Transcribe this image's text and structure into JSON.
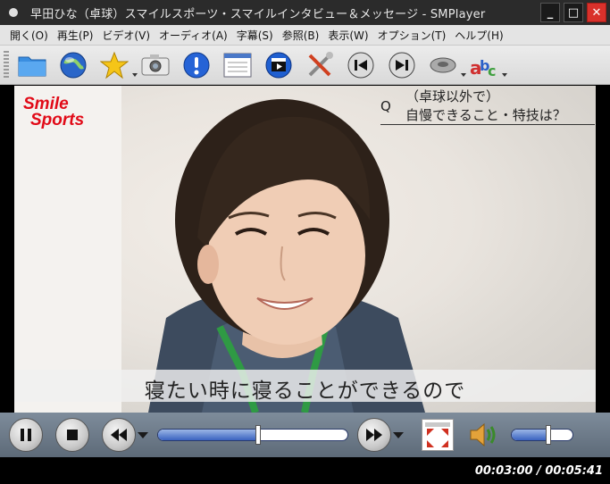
{
  "window": {
    "title": "早田ひな（卓球）スマイルスポーツ・スマイルインタビュー＆メッセージ - SMPlayer",
    "minimize_label": "_",
    "maximize_label": "□",
    "close_label": "✕"
  },
  "menu": {
    "items": [
      "開く(O)",
      "再生(P)",
      "ビデオ(V)",
      "オーディオ(A)",
      "字幕(S)",
      "参照(B)",
      "表示(W)",
      "オプション(T)",
      "ヘルプ(H)"
    ]
  },
  "toolbar": {
    "icons": [
      "folder-icon",
      "globe-icon",
      "star-icon",
      "camera-icon",
      "info-icon",
      "playlist-icon",
      "media-clapper-icon",
      "settings-tools-icon",
      "previous-icon",
      "next-icon",
      "audio-track-icon",
      "subtitle-abc-icon"
    ]
  },
  "video": {
    "logo_line1": "Smile",
    "logo_line2": "Sports",
    "question_mark": "Q",
    "question_line1": "（卓球以外で）",
    "question_line2": "自慢できること・特技は？",
    "subtitle": "寝たい時に寝ることができるので"
  },
  "controls": {
    "seek_fraction": 0.53,
    "volume_fraction": 0.6
  },
  "status": {
    "time": "00:03:00 / 00:05:41"
  },
  "colors": {
    "logo_red": "#e10a17",
    "close_red": "#d9312b",
    "control_bar": "#6e7b89"
  }
}
